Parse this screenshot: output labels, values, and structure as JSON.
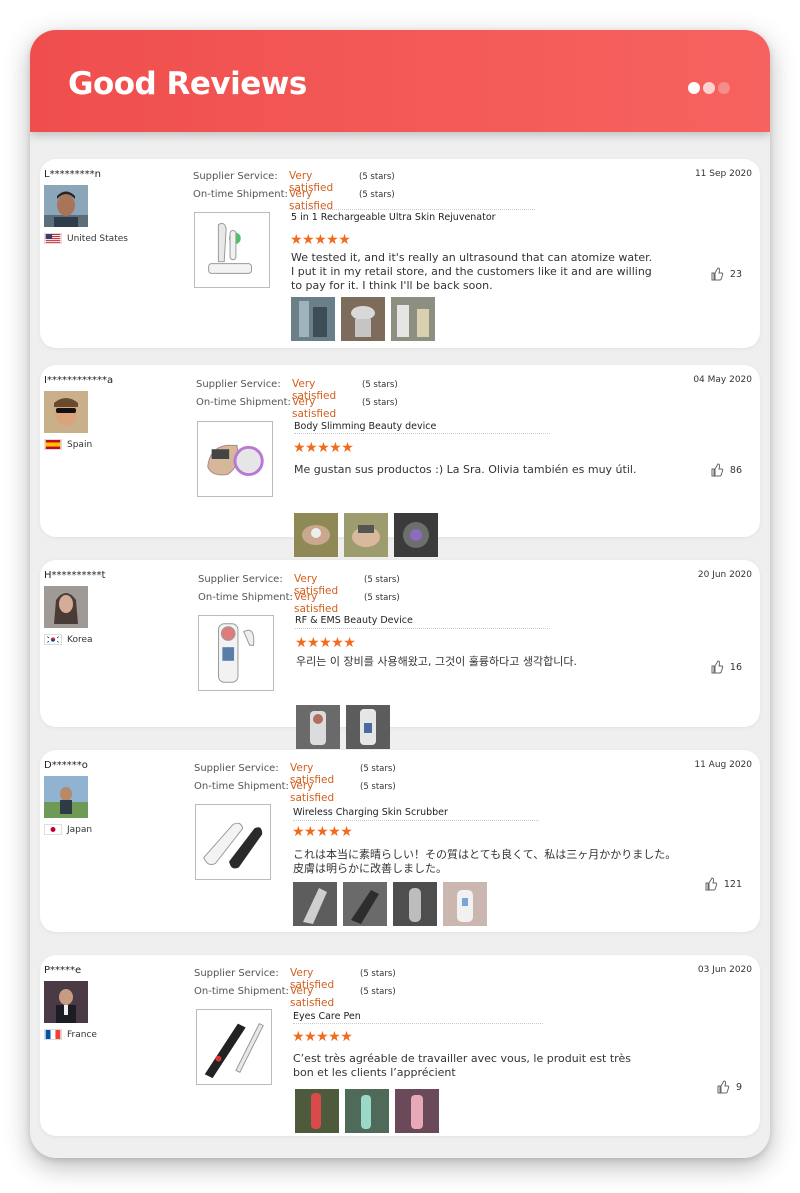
{
  "header": {
    "title": "Good Reviews"
  },
  "labels": {
    "supplier_service": "Supplier Service:",
    "on_time_shipment": "On-time Shipment:"
  },
  "colors": {
    "header": "#ef4e4d",
    "accent": "#d35f1d",
    "stars": "#f26b1d"
  },
  "reviews": [
    {
      "user": "L*********n",
      "country": "United States",
      "date": "11 Sep 2020",
      "supplier_value": "Very satisfied",
      "supplier_stars": "(5 stars)",
      "shipment_value": "Very satisfied",
      "shipment_stars": "(5 stars)",
      "product": "5 in 1 Rechargeable Ultra Skin Rejuvenator",
      "rating": 5,
      "text_lines": [
        "We tested it, and it's really an ultrasound that can atomize water.",
        "I put it in my retail store, and the customers like it and are willing",
        "to pay for it. I think I'll be back soon."
      ],
      "likes": "23",
      "photo_count": 3
    },
    {
      "user": "I************a",
      "country": "Spain",
      "date": "04 May 2020",
      "supplier_value": "Very satisfied",
      "supplier_stars": "(5 stars)",
      "shipment_value": "Very satisfied",
      "shipment_stars": "(5 stars)",
      "product": "Body Slimming Beauty device",
      "rating": 5,
      "text_lines": [
        "Me gustan sus productos :) La Sra. Olivia también es muy útil."
      ],
      "likes": "86",
      "photo_count": 3
    },
    {
      "user": "H**********t",
      "country": "Korea",
      "date": "20 Jun 2020",
      "supplier_value": "Very satisfied",
      "supplier_stars": "(5 stars)",
      "shipment_value": "Very satisfied",
      "shipment_stars": "(5 stars)",
      "product": "RF & EMS Beauty Device",
      "rating": 5,
      "text_lines": [
        "우리는 이 장비를 사용해왔고, 그것이 훌륭하다고 생각합니다."
      ],
      "likes": "16",
      "photo_count": 2
    },
    {
      "user": "D******o",
      "country": "Japan",
      "date": "11 Aug 2020",
      "supplier_value": "Very satisfied",
      "supplier_stars": "(5 stars)",
      "shipment_value": "Very satisfied",
      "shipment_stars": "(5 stars)",
      "product": "Wireless Charging Skin Scrubber",
      "rating": 5,
      "text_lines": [
        "これは本当に素晴らしい！その質はとても良くて、私は三ヶ月かかりました。",
        "皮膚は明らかに改善しました。"
      ],
      "likes": "121",
      "photo_count": 4
    },
    {
      "user": "P*****e",
      "country": "France",
      "date": "03 Jun 2020",
      "supplier_value": "Very satisfied",
      "supplier_stars": "(5 stars)",
      "shipment_value": "Very satisfied",
      "shipment_stars": "(5 stars)",
      "product": "Eyes Care Pen",
      "rating": 5,
      "text_lines": [
        "C’est très agréable de travailler avec vous, le produit est très",
        "bon et les clients l’apprécient"
      ],
      "likes": "9",
      "photo_count": 3
    }
  ]
}
